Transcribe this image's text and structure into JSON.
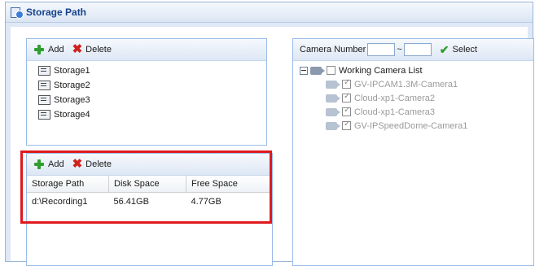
{
  "window": {
    "title": "Storage Path"
  },
  "storage_panel": {
    "add_label": "Add",
    "delete_label": "Delete",
    "items": [
      "Storage1",
      "Storage2",
      "Storage3",
      "Storage4"
    ]
  },
  "path_panel": {
    "add_label": "Add",
    "delete_label": "Delete",
    "columns": [
      "Storage Path",
      "Disk Space",
      "Free Space"
    ],
    "rows": [
      {
        "path": "d:\\Recording1",
        "disk": "56.41GB",
        "free": "4.77GB"
      }
    ]
  },
  "camera_panel": {
    "number_label": "Camera Number",
    "range_sep": "~",
    "select_label": "Select",
    "from_value": "",
    "to_value": "",
    "root_label": "Working Camera List",
    "cameras": [
      "GV-IPCAM1.3M-Camera1",
      "Cloud-xp1-Camera2",
      "Cloud-xp1-Camera3",
      "GV-IPSpeedDome-Camera1"
    ]
  },
  "colors": {
    "highlight": "#e0191d",
    "accent": "#15428b"
  }
}
